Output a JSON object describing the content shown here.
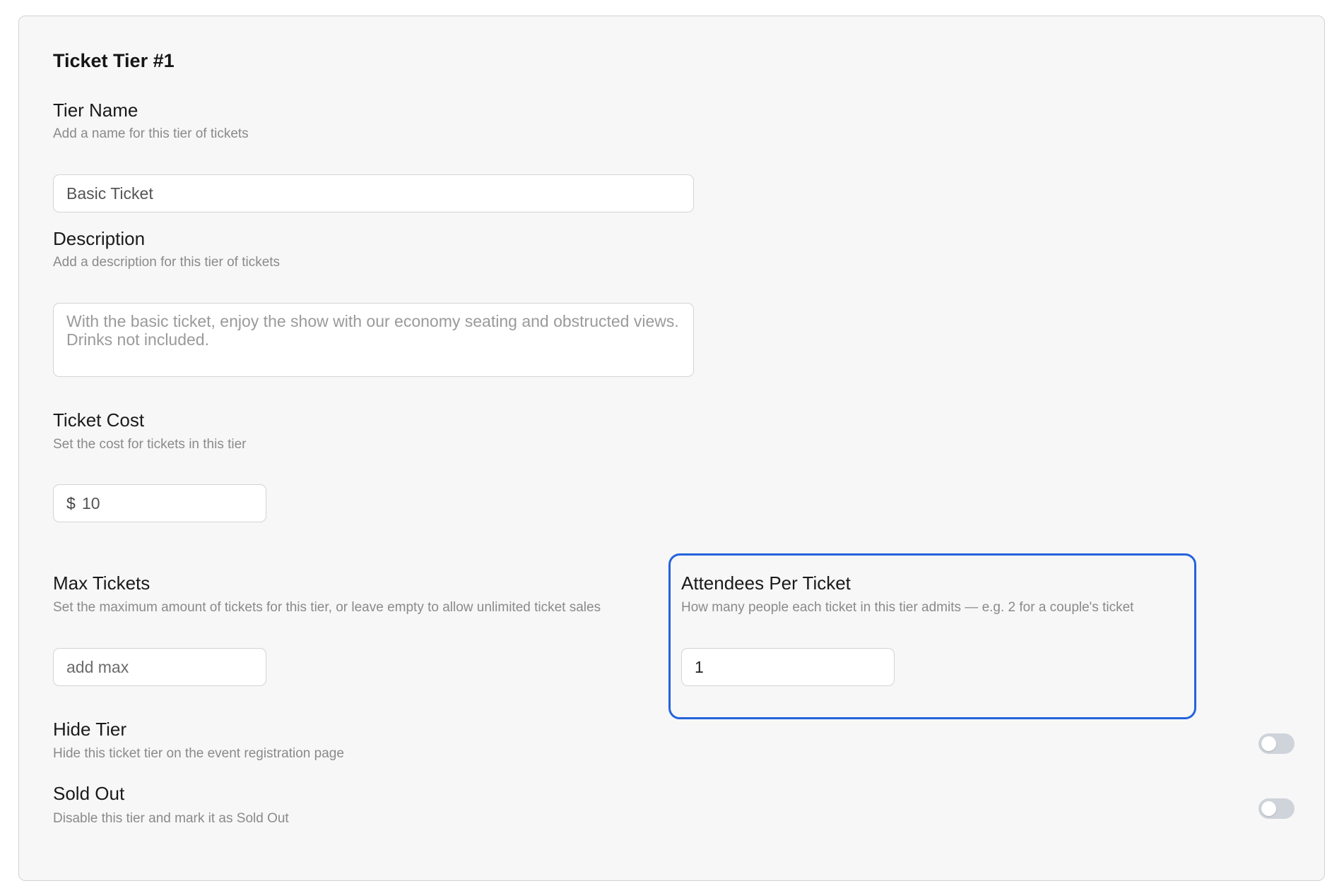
{
  "tier": {
    "title": "Ticket Tier #1",
    "name": {
      "label": "Tier Name",
      "help": "Add a name for this tier of tickets",
      "value": "Basic Ticket"
    },
    "description": {
      "label": "Description",
      "help": "Add a description for this tier of tickets",
      "placeholder": "With the basic ticket, enjoy the show with our economy seating and obstructed views. Drinks not included."
    },
    "cost": {
      "label": "Ticket Cost",
      "help": "Set the cost for tickets in this tier",
      "currency_symbol": "$",
      "value": "10"
    },
    "max_tickets": {
      "label": "Max Tickets",
      "help": "Set the maximum amount of tickets for this tier, or leave empty to allow unlimited ticket sales",
      "placeholder": "add max"
    },
    "attendees": {
      "label": "Attendees Per Ticket",
      "help": "How many people each ticket in this tier admits — e.g. 2 for a couple's ticket",
      "value": "1"
    },
    "hide_tier": {
      "label": "Hide Tier",
      "help": "Hide this ticket tier on the event registration page",
      "enabled": false
    },
    "sold_out": {
      "label": "Sold Out",
      "help": "Disable this tier and mark it as Sold Out",
      "enabled": false
    }
  },
  "colors": {
    "highlight": "#2463dd",
    "toggle_off": "#cfd3da",
    "card_background": "#f7f7f7"
  }
}
